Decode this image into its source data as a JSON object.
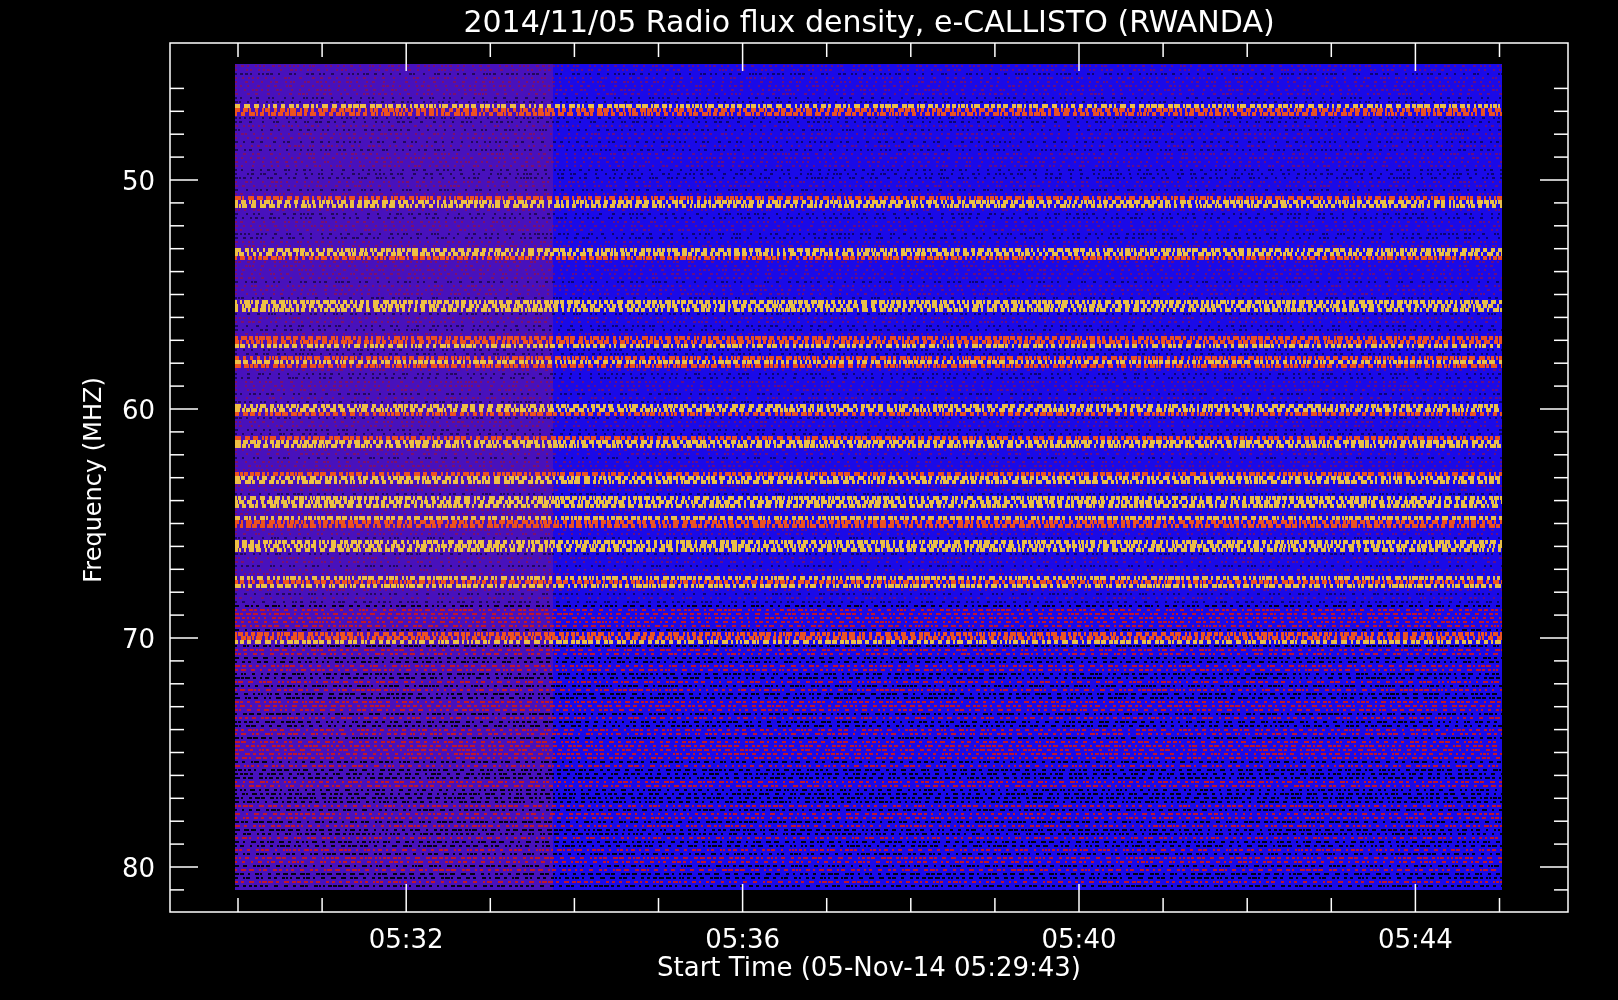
{
  "title": "2014/11/05  Radio flux density, e-CALLISTO (RWANDA)",
  "y_axis": {
    "label": "Frequency (MHZ)",
    "ticks": [
      "50",
      "60",
      "70",
      "80"
    ]
  },
  "x_axis": {
    "label": "Start Time (05-Nov-14 05:29:43)",
    "ticks": [
      "05:32",
      "05:36",
      "05:40",
      "05:44"
    ]
  }
}
